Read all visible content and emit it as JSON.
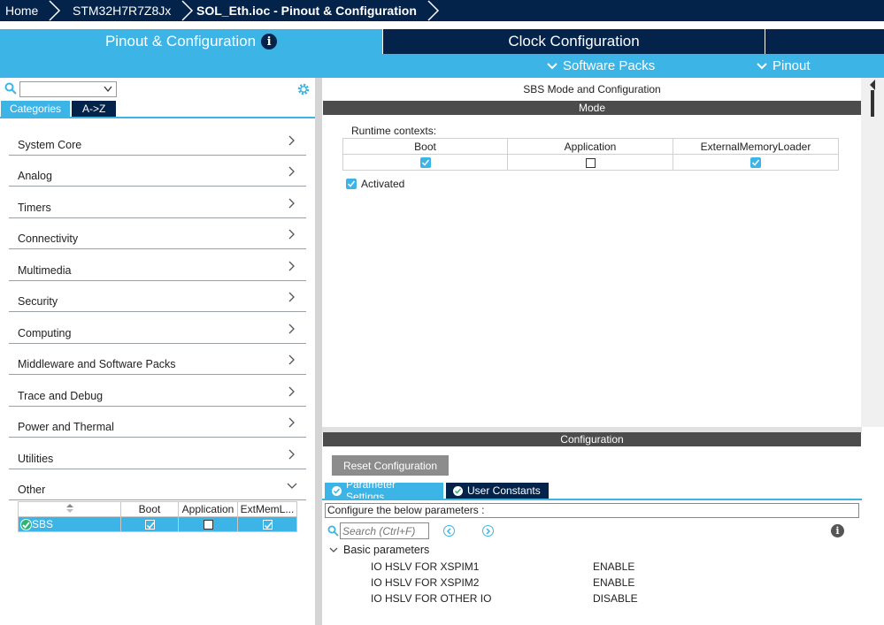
{
  "breadcrumb": [
    "Home",
    "STM32H7R7Z8Jx",
    "SOL_Eth.ioc - Pinout & Configuration"
  ],
  "tabs": {
    "pinout": "Pinout & Configuration",
    "clock": "Clock Configuration",
    "info_glyph": "i"
  },
  "subbar": {
    "software_packs": "Software Packs",
    "pinout": "Pinout"
  },
  "left": {
    "search_value": "",
    "tab_categories": "Categories",
    "tab_az": "A->Z",
    "categories": [
      "System Core",
      "Analog",
      "Timers",
      "Connectivity",
      "Multimedia",
      "Security",
      "Computing",
      "Middleware and Software Packs",
      "Trace and Debug",
      "Power and Thermal",
      "Utilities",
      "Other"
    ],
    "expanded_category": "Other",
    "sbs_table": {
      "headers": [
        "",
        "Boot",
        "Application",
        "ExtMemL..."
      ],
      "row": {
        "name": "SBS",
        "boot": true,
        "application": false,
        "extmem": true
      }
    }
  },
  "right": {
    "title": "SBS Mode and Configuration",
    "mode_header": "Mode",
    "runtime_label": "Runtime contexts:",
    "runtime_headers": [
      "Boot",
      "Application",
      "ExternalMemoryLoader"
    ],
    "runtime_values": [
      true,
      false,
      true
    ],
    "activated_label": "Activated",
    "activated": true,
    "config_header": "Configuration",
    "reset_button": "Reset Configuration",
    "tab_params": "Parameter Settings",
    "tab_constants": "User Constants",
    "configure_text": "Configure the below parameters :",
    "search_placeholder": "Search (Ctrl+F)",
    "group_label": "Basic parameters",
    "params": [
      {
        "name": "IO HSLV FOR XSPIM1",
        "value": "ENABLE"
      },
      {
        "name": "IO HSLV FOR XSPIM2",
        "value": "ENABLE"
      },
      {
        "name": "IO HSLV FOR OTHER IO",
        "value": "DISABLE"
      }
    ]
  },
  "colors": {
    "navy": "#03234b",
    "accent": "#3cb4e6",
    "header_grey": "#4c4c4c"
  }
}
